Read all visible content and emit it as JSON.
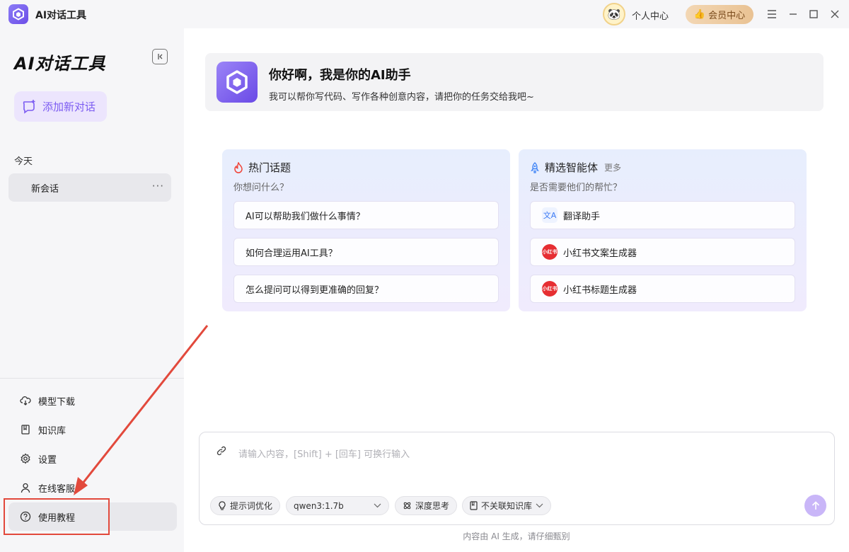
{
  "app": {
    "name": "AI对话工具"
  },
  "titlebar": {
    "user_center": "个人中心",
    "vip": "会员中心"
  },
  "sidebar": {
    "title": "AI对话工具",
    "new_chat": "添加新对话",
    "section_today": "今天",
    "conversations": [
      {
        "label": "新会话",
        "more": "···"
      }
    ],
    "menu": [
      {
        "label": "模型下载",
        "icon": "cloud-download-icon"
      },
      {
        "label": "知识库",
        "icon": "book-icon"
      },
      {
        "label": "设置",
        "icon": "gear-icon"
      },
      {
        "label": "在线客服",
        "icon": "user-icon"
      },
      {
        "label": "使用教程",
        "icon": "help-circle-icon"
      }
    ]
  },
  "greeting": {
    "title": "你好啊，我是你的AI助手",
    "subtitle": "我可以帮你写代码、写作各种创意内容，请把你的任务交给我吧~"
  },
  "hot_topics": {
    "title": "热门话题",
    "subtitle": "你想问什么？",
    "items": [
      "AI可以帮助我们做什么事情？",
      "如何合理运用AI工具？",
      "怎么提问可以得到更准确的回复？"
    ]
  },
  "agents": {
    "title": "精选智能体",
    "more": "更多",
    "subtitle": "是否需要他们的帮忙？",
    "items": [
      {
        "label": "翻译助手",
        "badge": "文A"
      },
      {
        "label": "小红书文案生成器",
        "badge": "小红书"
      },
      {
        "label": "小红书标题生成器",
        "badge": "小红书"
      }
    ]
  },
  "input": {
    "placeholder": "请输入内容，[Shift] + [回车] 可换行输入",
    "prompt_optimize": "提示词优化",
    "model": "qwen3:1.7b",
    "deep_think": "深度思考",
    "knowledge": "不关联知识库"
  },
  "footer": {
    "note": "内容由 AI 生成，请仔细甄别"
  },
  "colors": {
    "accent": "#7c5cf2",
    "highlight": "#e2493c",
    "vip": "#e9c293"
  }
}
